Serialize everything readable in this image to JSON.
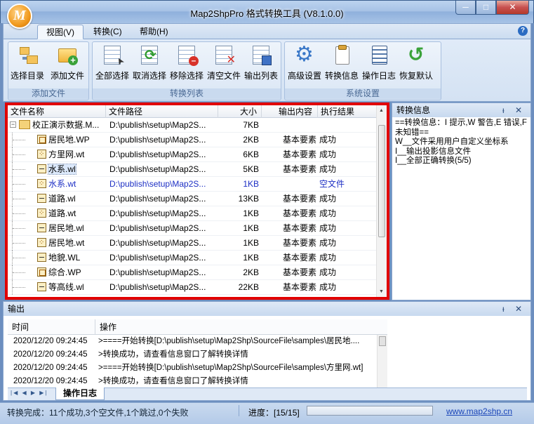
{
  "window": {
    "title": "Map2ShpPro 格式转换工具 (V8.1.0.0)",
    "min": "─",
    "max": "□",
    "close": "✕"
  },
  "ribbon": {
    "tabs": [
      "视图(V)",
      "转换(C)",
      "帮助(H)"
    ],
    "help": "?",
    "groups": {
      "add": {
        "label": "添加文件",
        "buttons": [
          "选择目录",
          "添加文件"
        ]
      },
      "list": {
        "label": "转换列表",
        "buttons": [
          "全部选择",
          "取消选择",
          "移除选择",
          "清空文件",
          "输出列表"
        ]
      },
      "settings": {
        "label": "系统设置",
        "buttons": [
          "高级设置",
          "转换信息",
          "操作日志",
          "恢复默认"
        ]
      }
    }
  },
  "file_list": {
    "columns": [
      "文件名称",
      "文件路径",
      "大小",
      "输出内容",
      "执行结果"
    ],
    "rows": [
      {
        "icon": "folder",
        "name": "校正演示数据.M...",
        "path": "D:\\publish\\setup\\Map2S...",
        "size": "7KB",
        "out": "",
        "res": ""
      },
      {
        "icon": "poly",
        "name": "居民地.WP",
        "path": "D:\\publish\\setup\\Map2S...",
        "size": "2KB",
        "out": "基本要素",
        "res": "成功"
      },
      {
        "icon": "point",
        "name": "方里网.wt",
        "path": "D:\\publish\\setup\\Map2S...",
        "size": "6KB",
        "out": "基本要素",
        "res": "成功"
      },
      {
        "icon": "line",
        "name": "水系.wl",
        "path": "D:\\publish\\setup\\Map2S...",
        "size": "5KB",
        "out": "基本要素",
        "res": "成功"
      },
      {
        "icon": "point",
        "name": "水系.wt",
        "path": "D:\\publish\\setup\\Map2S...",
        "size": "1KB",
        "out": "",
        "res": "空文件",
        "blue": true
      },
      {
        "icon": "line",
        "name": "道路.wl",
        "path": "D:\\publish\\setup\\Map2S...",
        "size": "13KB",
        "out": "基本要素",
        "res": "成功"
      },
      {
        "icon": "point",
        "name": "道路.wt",
        "path": "D:\\publish\\setup\\Map2S...",
        "size": "1KB",
        "out": "基本要素",
        "res": "成功"
      },
      {
        "icon": "line",
        "name": "居民地.wl",
        "path": "D:\\publish\\setup\\Map2S...",
        "size": "1KB",
        "out": "基本要素",
        "res": "成功"
      },
      {
        "icon": "point",
        "name": "居民地.wt",
        "path": "D:\\publish\\setup\\Map2S...",
        "size": "1KB",
        "out": "基本要素",
        "res": "成功"
      },
      {
        "icon": "line",
        "name": "地貌.WL",
        "path": "D:\\publish\\setup\\Map2S...",
        "size": "1KB",
        "out": "基本要素",
        "res": "成功"
      },
      {
        "icon": "poly",
        "name": "综合.WP",
        "path": "D:\\publish\\setup\\Map2S...",
        "size": "2KB",
        "out": "基本要素",
        "res": "成功"
      },
      {
        "icon": "line",
        "name": "等高线.wl",
        "path": "D:\\publish\\setup\\Map2S...",
        "size": "22KB",
        "out": "基本要素",
        "res": "成功"
      }
    ]
  },
  "info_panel": {
    "title": "转换信息",
    "buttons": "ᵻ ✕",
    "text": "==转换信息：I 提示,W 警告,E 错误,F 未知错==\nW__文件采用用户自定义坐标系\nI__输出投影信息文件\nI__全部正确转换(5/5)"
  },
  "output_panel": {
    "title": "输出",
    "buttons": "ᵻ ✕",
    "columns": [
      "时间",
      "操作"
    ],
    "rows": [
      {
        "time": "2020/12/20 09:24:45",
        "msg": ">====开始转换[D:\\publish\\setup\\Map2Shp\\SourceFile\\samples\\居民地...."
      },
      {
        "time": "2020/12/20 09:24:45",
        "msg": ">转换成功，请查看信息窗口了解转换详情"
      },
      {
        "time": "2020/12/20 09:24:45",
        "msg": ">====开始转换[D:\\publish\\setup\\Map2Shp\\SourceFile\\samples\\方里网.wt]"
      },
      {
        "time": "2020/12/20 09:24:45",
        "msg": ">转换成功，请查看信息窗口了解转换详情"
      }
    ],
    "nav": "|◀ ◀ ▶ ▶|",
    "tab": "操作日志"
  },
  "status": {
    "summary": "转换完成：11个成功,3个空文件,1个跳过,0个失败",
    "progress_label": "进度：[15/15]",
    "progress": 1.0,
    "link": "www.map2shp.cn"
  }
}
